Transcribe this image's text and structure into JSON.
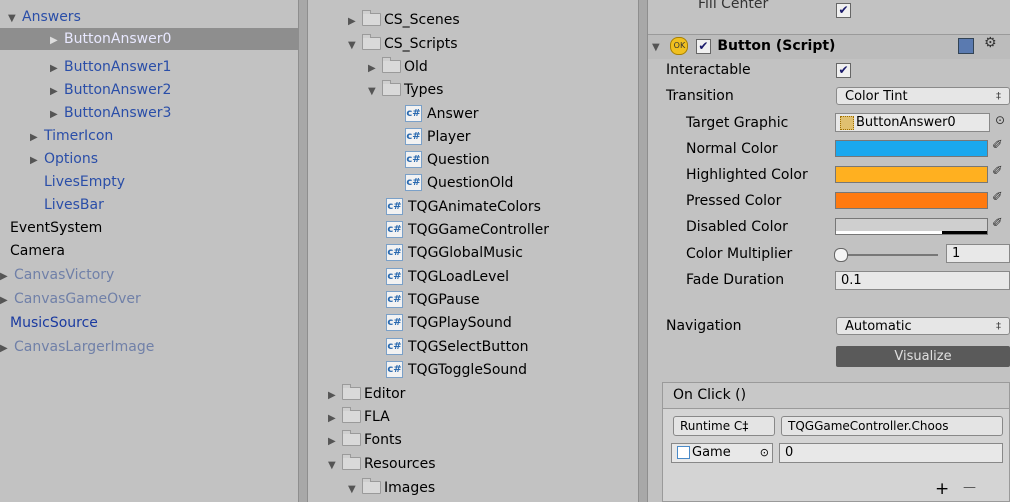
{
  "hierarchy": {
    "items": [
      {
        "label": "Answers",
        "expanded": true
      },
      {
        "label": "ButtonAnswer0",
        "selected": true
      },
      {
        "label": "ButtonAnswer1"
      },
      {
        "label": "ButtonAnswer2"
      },
      {
        "label": "ButtonAnswer3"
      },
      {
        "label": "TimerIcon"
      },
      {
        "label": "Options"
      },
      {
        "label": "LivesEmpty"
      },
      {
        "label": "LivesBar"
      },
      {
        "label": "EventSystem"
      },
      {
        "label": "Camera"
      },
      {
        "label": "CanvasVictory"
      },
      {
        "label": "CanvasGameOver"
      },
      {
        "label": "MusicSource"
      },
      {
        "label": "CanvasLargerImage"
      }
    ]
  },
  "project": {
    "items": [
      {
        "label": "CS_Scenes",
        "kind": "folder"
      },
      {
        "label": "CS_Scripts",
        "kind": "folder"
      },
      {
        "label": "Old",
        "kind": "folder"
      },
      {
        "label": "Types",
        "kind": "folder"
      },
      {
        "label": "Answer",
        "kind": "script"
      },
      {
        "label": "Player",
        "kind": "script"
      },
      {
        "label": "Question",
        "kind": "script"
      },
      {
        "label": "QuestionOld",
        "kind": "script"
      },
      {
        "label": "TQGAnimateColors",
        "kind": "script"
      },
      {
        "label": "TQGGameController",
        "kind": "script"
      },
      {
        "label": "TQGGlobalMusic",
        "kind": "script"
      },
      {
        "label": "TQGLoadLevel",
        "kind": "script"
      },
      {
        "label": "TQGPause",
        "kind": "script"
      },
      {
        "label": "TQGPlaySound",
        "kind": "script"
      },
      {
        "label": "TQGSelectButton",
        "kind": "script"
      },
      {
        "label": "TQGToggleSound",
        "kind": "script"
      },
      {
        "label": "Editor",
        "kind": "folder"
      },
      {
        "label": "FLA",
        "kind": "folder"
      },
      {
        "label": "Fonts",
        "kind": "folder"
      },
      {
        "label": "Resources",
        "kind": "folder"
      },
      {
        "label": "Images",
        "kind": "folder"
      }
    ]
  },
  "inspector": {
    "fill_center_label": "Fill Center",
    "component_title": "Button (Script)",
    "component_badge": "OK",
    "interactable_label": "Interactable",
    "transition_label": "Transition",
    "transition_value": "Color Tint",
    "target_graphic_label": "Target Graphic",
    "target_graphic_value": "ButtonAnswer0",
    "normal_color_label": "Normal Color",
    "highlighted_color_label": "Highlighted Color",
    "pressed_color_label": "Pressed Color",
    "disabled_color_label": "Disabled Color",
    "color_multiplier_label": "Color Multiplier",
    "color_multiplier_value": "1",
    "color_multiplier_fraction": 0.0,
    "fade_duration_label": "Fade Duration",
    "fade_duration_value": "0.1",
    "navigation_label": "Navigation",
    "navigation_value": "Automatic",
    "visualize_label": "Visualize",
    "onclick_title": "On Click ()",
    "runtime_value": "Runtime C‡",
    "function_value": "TQGGameController.Choos",
    "object_value": "Game",
    "arg_value": "0",
    "add_symbol": "+",
    "remove_symbol": "—",
    "colors": {
      "normal": "#1aa8ee",
      "highlighted": "#ffb020",
      "pressed": "#ff7a10",
      "disabled": "#cfcfcf"
    }
  }
}
